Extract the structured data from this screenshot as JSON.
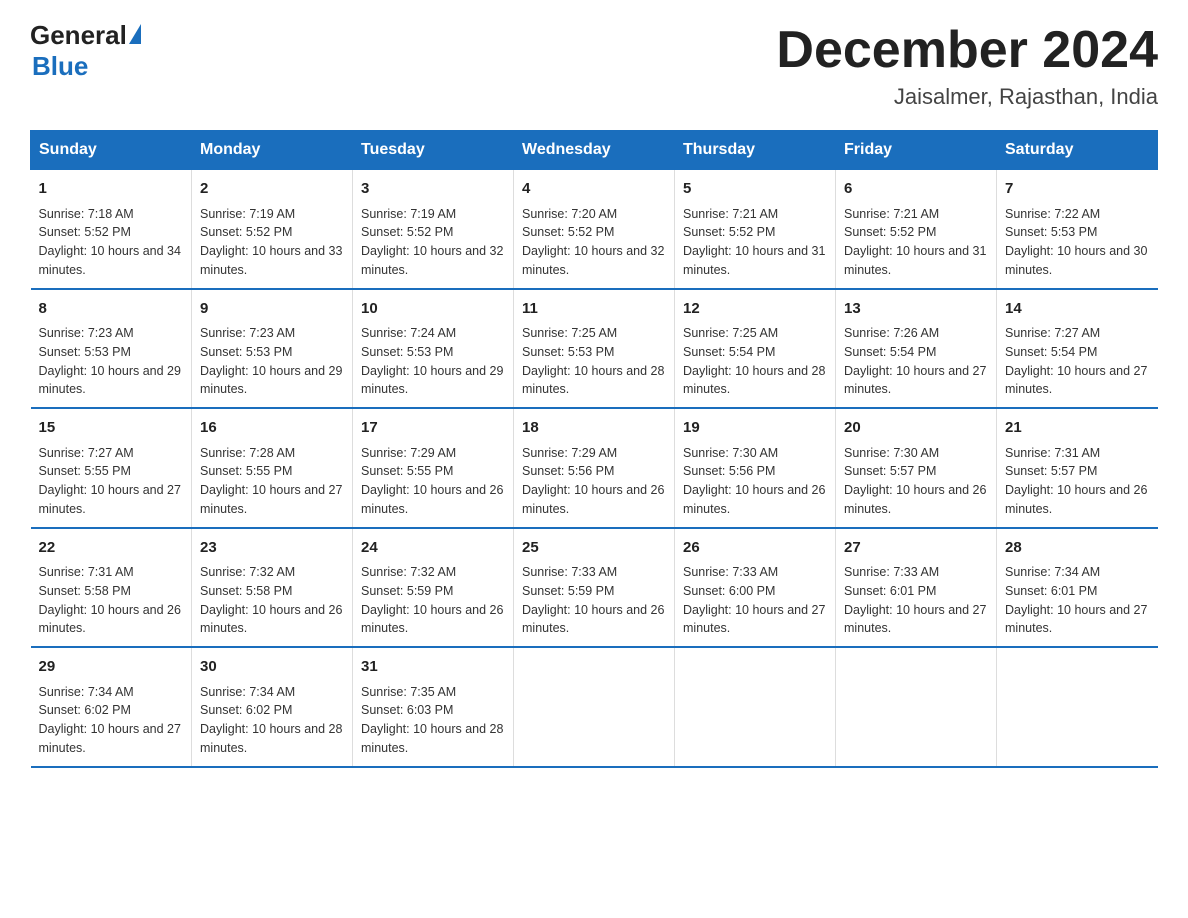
{
  "header": {
    "logo_general": "General",
    "logo_blue": "Blue",
    "title": "December 2024",
    "subtitle": "Jaisalmer, Rajasthan, India"
  },
  "calendar": {
    "days_of_week": [
      "Sunday",
      "Monday",
      "Tuesday",
      "Wednesday",
      "Thursday",
      "Friday",
      "Saturday"
    ],
    "weeks": [
      [
        {
          "day": "1",
          "sunrise": "7:18 AM",
          "sunset": "5:52 PM",
          "daylight": "10 hours and 34 minutes."
        },
        {
          "day": "2",
          "sunrise": "7:19 AM",
          "sunset": "5:52 PM",
          "daylight": "10 hours and 33 minutes."
        },
        {
          "day": "3",
          "sunrise": "7:19 AM",
          "sunset": "5:52 PM",
          "daylight": "10 hours and 32 minutes."
        },
        {
          "day": "4",
          "sunrise": "7:20 AM",
          "sunset": "5:52 PM",
          "daylight": "10 hours and 32 minutes."
        },
        {
          "day": "5",
          "sunrise": "7:21 AM",
          "sunset": "5:52 PM",
          "daylight": "10 hours and 31 minutes."
        },
        {
          "day": "6",
          "sunrise": "7:21 AM",
          "sunset": "5:52 PM",
          "daylight": "10 hours and 31 minutes."
        },
        {
          "day": "7",
          "sunrise": "7:22 AM",
          "sunset": "5:53 PM",
          "daylight": "10 hours and 30 minutes."
        }
      ],
      [
        {
          "day": "8",
          "sunrise": "7:23 AM",
          "sunset": "5:53 PM",
          "daylight": "10 hours and 29 minutes."
        },
        {
          "day": "9",
          "sunrise": "7:23 AM",
          "sunset": "5:53 PM",
          "daylight": "10 hours and 29 minutes."
        },
        {
          "day": "10",
          "sunrise": "7:24 AM",
          "sunset": "5:53 PM",
          "daylight": "10 hours and 29 minutes."
        },
        {
          "day": "11",
          "sunrise": "7:25 AM",
          "sunset": "5:53 PM",
          "daylight": "10 hours and 28 minutes."
        },
        {
          "day": "12",
          "sunrise": "7:25 AM",
          "sunset": "5:54 PM",
          "daylight": "10 hours and 28 minutes."
        },
        {
          "day": "13",
          "sunrise": "7:26 AM",
          "sunset": "5:54 PM",
          "daylight": "10 hours and 27 minutes."
        },
        {
          "day": "14",
          "sunrise": "7:27 AM",
          "sunset": "5:54 PM",
          "daylight": "10 hours and 27 minutes."
        }
      ],
      [
        {
          "day": "15",
          "sunrise": "7:27 AM",
          "sunset": "5:55 PM",
          "daylight": "10 hours and 27 minutes."
        },
        {
          "day": "16",
          "sunrise": "7:28 AM",
          "sunset": "5:55 PM",
          "daylight": "10 hours and 27 minutes."
        },
        {
          "day": "17",
          "sunrise": "7:29 AM",
          "sunset": "5:55 PM",
          "daylight": "10 hours and 26 minutes."
        },
        {
          "day": "18",
          "sunrise": "7:29 AM",
          "sunset": "5:56 PM",
          "daylight": "10 hours and 26 minutes."
        },
        {
          "day": "19",
          "sunrise": "7:30 AM",
          "sunset": "5:56 PM",
          "daylight": "10 hours and 26 minutes."
        },
        {
          "day": "20",
          "sunrise": "7:30 AM",
          "sunset": "5:57 PM",
          "daylight": "10 hours and 26 minutes."
        },
        {
          "day": "21",
          "sunrise": "7:31 AM",
          "sunset": "5:57 PM",
          "daylight": "10 hours and 26 minutes."
        }
      ],
      [
        {
          "day": "22",
          "sunrise": "7:31 AM",
          "sunset": "5:58 PM",
          "daylight": "10 hours and 26 minutes."
        },
        {
          "day": "23",
          "sunrise": "7:32 AM",
          "sunset": "5:58 PM",
          "daylight": "10 hours and 26 minutes."
        },
        {
          "day": "24",
          "sunrise": "7:32 AM",
          "sunset": "5:59 PM",
          "daylight": "10 hours and 26 minutes."
        },
        {
          "day": "25",
          "sunrise": "7:33 AM",
          "sunset": "5:59 PM",
          "daylight": "10 hours and 26 minutes."
        },
        {
          "day": "26",
          "sunrise": "7:33 AM",
          "sunset": "6:00 PM",
          "daylight": "10 hours and 27 minutes."
        },
        {
          "day": "27",
          "sunrise": "7:33 AM",
          "sunset": "6:01 PM",
          "daylight": "10 hours and 27 minutes."
        },
        {
          "day": "28",
          "sunrise": "7:34 AM",
          "sunset": "6:01 PM",
          "daylight": "10 hours and 27 minutes."
        }
      ],
      [
        {
          "day": "29",
          "sunrise": "7:34 AM",
          "sunset": "6:02 PM",
          "daylight": "10 hours and 27 minutes."
        },
        {
          "day": "30",
          "sunrise": "7:34 AM",
          "sunset": "6:02 PM",
          "daylight": "10 hours and 28 minutes."
        },
        {
          "day": "31",
          "sunrise": "7:35 AM",
          "sunset": "6:03 PM",
          "daylight": "10 hours and 28 minutes."
        },
        null,
        null,
        null,
        null
      ]
    ]
  }
}
